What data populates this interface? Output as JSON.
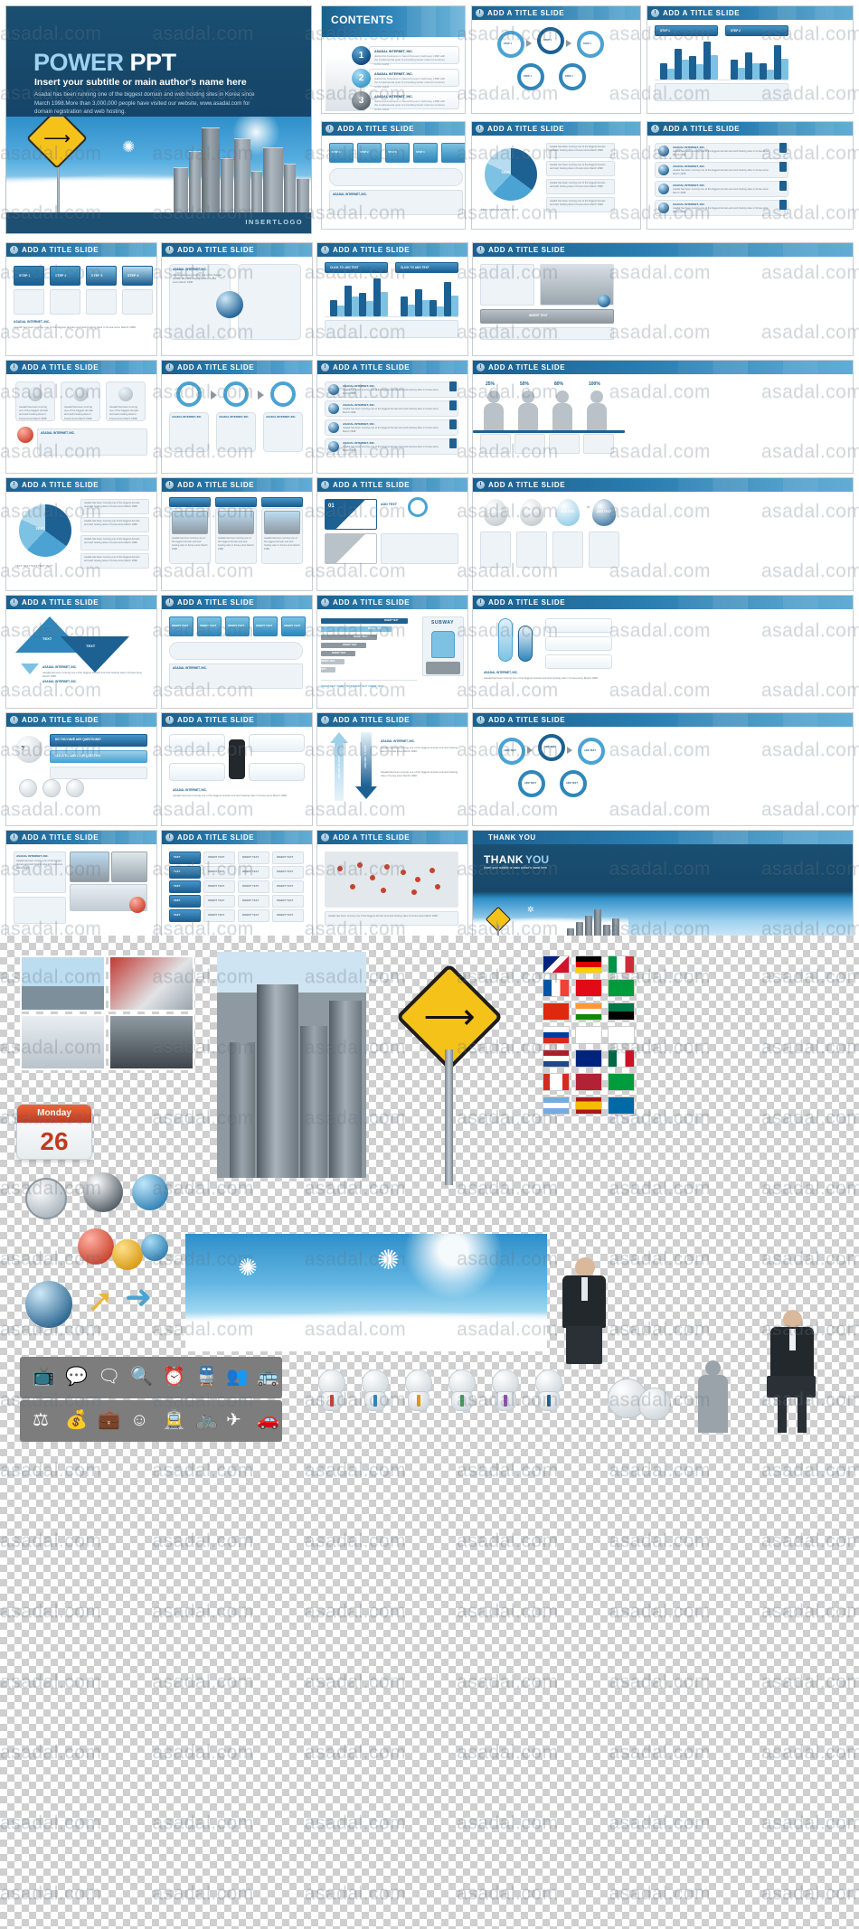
{
  "watermark": {
    "text": "asadal.com",
    "repeat": 6
  },
  "cover": {
    "title_primary": "POWER",
    "title_secondary": "PPT",
    "subtitle": "Insert your subtitle or  main author's name here",
    "body": "Asadal has been running one of the biggest domain and web hosting sites in Korea since March 1998.More than 3,000,000 people have visited our website, www.asadal.com for domain registration and web hosting.",
    "logo_label": "INSERTLOGO",
    "sign_icon": "right-turn-arrow-icon",
    "bird_icon": "seagull-icon",
    "bg_color": "#1a4f72",
    "accent_color": "#9fd3ef"
  },
  "contents_slide": {
    "title": "CONTENTS",
    "items": [
      {
        "num": "1",
        "heading": "ASADAL INTERNET, INC.",
        "body": "started its business in Seoul Korea in February 1998 with the fundamental goal of providing better internet services to the world."
      },
      {
        "num": "2",
        "heading": "ASADAL INTERNET, INC.",
        "body": "started its business in Seoul Korea in February 1998 with the fundamental goal of providing better internet services to the world."
      },
      {
        "num": "3",
        "heading": "ASADAL INTERNET, INC.",
        "body": "started its business in Seoul Korea in February 1998 with the fundamental goal of providing better internet services to the world."
      }
    ]
  },
  "slide_defaults": {
    "badge": "I",
    "title": "ADD A TITLE SLIDE",
    "header_color": "#1b5f8d",
    "header_gradient_end": "#59a9d3"
  },
  "common_labels": {
    "company": "ASADAL INTERNET, INC.",
    "body_short": "Asadal has been running one of the biggest domain and web hosting sites in Korea since March 1998.",
    "insert_text": "INSERT TEXT",
    "click_to_add_text": "CLICK TO ADD TEXT",
    "add_text": "ADD TEXT",
    "text": "TEXT",
    "step": "STEP",
    "do_you_have_any_questions": "DO YOU HAVE ANY QUESTIONS?",
    "click_to_add_your_question": "CLICK TO ADD YOUR QUESTION",
    "subway": "SUBWAY",
    "thank_you_1": "THANK",
    "thank_you_2": "YOU",
    "thank_you_sub": "Insert your subtitle or  main author's name here",
    "monday": "Monday",
    "day_number": "26"
  },
  "slides": [
    {
      "row": 1,
      "col": 1,
      "kind": "steps",
      "badge": "I",
      "title": "ADD A TITLE SLIDE",
      "items": [
        "STEP 1",
        "STEP 2",
        "STEP 3",
        "STEP 4"
      ]
    },
    {
      "row": 1,
      "col": 2,
      "kind": "twopanel",
      "badge": "I",
      "title": "ADD A TITLE SLIDE",
      "items": []
    },
    {
      "row": 1,
      "col": 3,
      "kind": "barchart",
      "badge": "I",
      "title": "ADD A TITLE SLIDE",
      "items": [
        "CLICK TO ADD TEXT",
        "CLICK TO ADD TEXT"
      ]
    },
    {
      "row": 1,
      "col": 4,
      "kind": "frames",
      "badge": "I",
      "title": "ADD A TITLE SLIDE",
      "items": [
        "INSERT TEXT"
      ]
    },
    {
      "row": 2,
      "col": 1,
      "kind": "cards3",
      "badge": "I",
      "title": "ADD A TITLE SLIDE",
      "items": [
        "ASADAL INTERNET, INC."
      ]
    },
    {
      "row": 2,
      "col": 2,
      "kind": "donut3",
      "badge": "I",
      "title": "ADD A TITLE SLIDE",
      "items": [
        "ASADAL INTERNET, INC."
      ]
    },
    {
      "row": 2,
      "col": 3,
      "kind": "list4",
      "badge": "I",
      "title": "ADD A TITLE SLIDE",
      "items": [
        "ASADAL INTERNET, INC."
      ]
    },
    {
      "row": 2,
      "col": 4,
      "kind": "people",
      "badge": "I",
      "title": "ADD A TITLE SLIDE",
      "items": [
        "25%",
        "50%",
        "80%",
        "100%"
      ]
    },
    {
      "row": 3,
      "col": 1,
      "kind": "pie",
      "badge": "I",
      "title": "ADD A TITLE SLIDE",
      "items": [
        "TEXT"
      ]
    },
    {
      "row": 3,
      "col": 2,
      "kind": "photos3",
      "badge": "I",
      "title": "ADD A TITLE SLIDE",
      "items": [
        "INSERT TEXT",
        "INSERT TEXT",
        "INSERT TEXT"
      ]
    },
    {
      "row": 3,
      "col": 3,
      "kind": "numbered",
      "badge": "I",
      "title": "ADD A TITLE SLIDE",
      "items": [
        "01",
        "ADD TEXT",
        "CLICK TO ADD TEXT"
      ]
    },
    {
      "row": 3,
      "col": 4,
      "kind": "drops",
      "badge": "I",
      "title": "ADD A TITLE SLIDE",
      "items": [
        "ADD TEXT",
        "ADD TEXT",
        "ADD TEXT",
        "ADD TEXT"
      ]
    },
    {
      "row": 4,
      "col": 1,
      "kind": "triangles",
      "badge": "I",
      "title": "ADD A TITLE SLIDE",
      "items": [
        "TEXT",
        "TEXT"
      ]
    },
    {
      "row": 4,
      "col": 2,
      "kind": "tabs5",
      "badge": "I",
      "title": "ADD A TITLE SLIDE",
      "items": [
        "INSERT TEXT",
        "INSERT TEXT",
        "INSERT TEXT",
        "INSERT TEXT",
        "INSERT TEXT"
      ]
    },
    {
      "row": 4,
      "col": 3,
      "kind": "hbars",
      "badge": "I",
      "title": "ADD A TITLE SLIDE",
      "items": [
        "SUBWAY",
        "INSERT TEXT"
      ]
    },
    {
      "row": 4,
      "col": 4,
      "kind": "bottles",
      "badge": "I",
      "title": "ADD A TITLE SLIDE",
      "items": [
        "ASADAL INTERNET, INC."
      ]
    },
    {
      "row": 5,
      "col": 1,
      "kind": "qa",
      "badge": "I",
      "title": "ADD A TITLE SLIDE",
      "items": [
        "DO YOU HAVE ANY QUESTIONS?",
        "CLICK TO ADD YOUR QUESTION"
      ]
    },
    {
      "row": 5,
      "col": 2,
      "kind": "speech",
      "badge": "I",
      "title": "ADD A TITLE SLIDE",
      "items": [
        "ASADAL INTERNET, INC."
      ]
    },
    {
      "row": 5,
      "col": 3,
      "kind": "arrows2",
      "badge": "I",
      "title": "ADD A TITLE SLIDE",
      "items": [
        "CLICK TO ADD TEXT",
        "CLICK TO ADD TEXT",
        "ASADAL INTERNET, INC."
      ]
    },
    {
      "row": 5,
      "col": 4,
      "kind": "rings5",
      "badge": "I",
      "title": "ADD A TITLE SLIDE",
      "items": [
        "ADD TEXT"
      ]
    },
    {
      "row": 6,
      "col": 1,
      "kind": "photopanel",
      "badge": "I",
      "title": "ADD A TITLE SLIDE",
      "items": [
        "ASADAL INTERNET, INC."
      ]
    },
    {
      "row": 6,
      "col": 2,
      "kind": "table",
      "badge": "I",
      "title": "ADD A TITLE SLIDE",
      "items": [
        "TEXT",
        "INSERT TEXT"
      ]
    },
    {
      "row": 6,
      "col": 3,
      "kind": "worldmap",
      "badge": "I",
      "title": "ADD A TITLE SLIDE",
      "items": []
    },
    {
      "row": 6,
      "col": 4,
      "kind": "thankyou",
      "badge": "",
      "title": "THANK YOU",
      "items": []
    }
  ],
  "assets": {
    "photo_grid_labels": [
      "city-road-photo",
      "red-building-photo",
      "interior-photo",
      "car-photo"
    ],
    "calendar": {
      "month_label": "Monday",
      "day": "26"
    },
    "flags": [
      "UK",
      "Germany",
      "Italy",
      "France",
      "Turkey",
      "Brazil-banner",
      "China",
      "India",
      "South-Africa",
      "Russia",
      "South-Korea",
      "Japan",
      "Netherlands",
      "Australia",
      "Mexico",
      "Canada",
      "USA",
      "Brazil",
      "Argentina",
      "Spain",
      "Sweden"
    ],
    "icon_row_1": [
      "tv-icon",
      "speech-bubble-icon",
      "chat-icon",
      "search-icon",
      "clock-icon",
      "train-icon",
      "people-icon",
      "bus-icon"
    ],
    "icon_row_2": [
      "scale-icon",
      "money-icon",
      "briefcase-icon",
      "smiley-icon",
      "tram-icon",
      "bicycle-icon",
      "airplane-icon",
      "car-icon"
    ],
    "objects": [
      "compass-icon",
      "gears-icon",
      "globe-icon",
      "arrows-icon",
      "skyscraper-photo",
      "road-sign-photo",
      "sky-seagull-photo",
      "businessman-photo",
      "mascot-figures",
      "money-bags-icon",
      "person-silhouette-icon"
    ]
  }
}
